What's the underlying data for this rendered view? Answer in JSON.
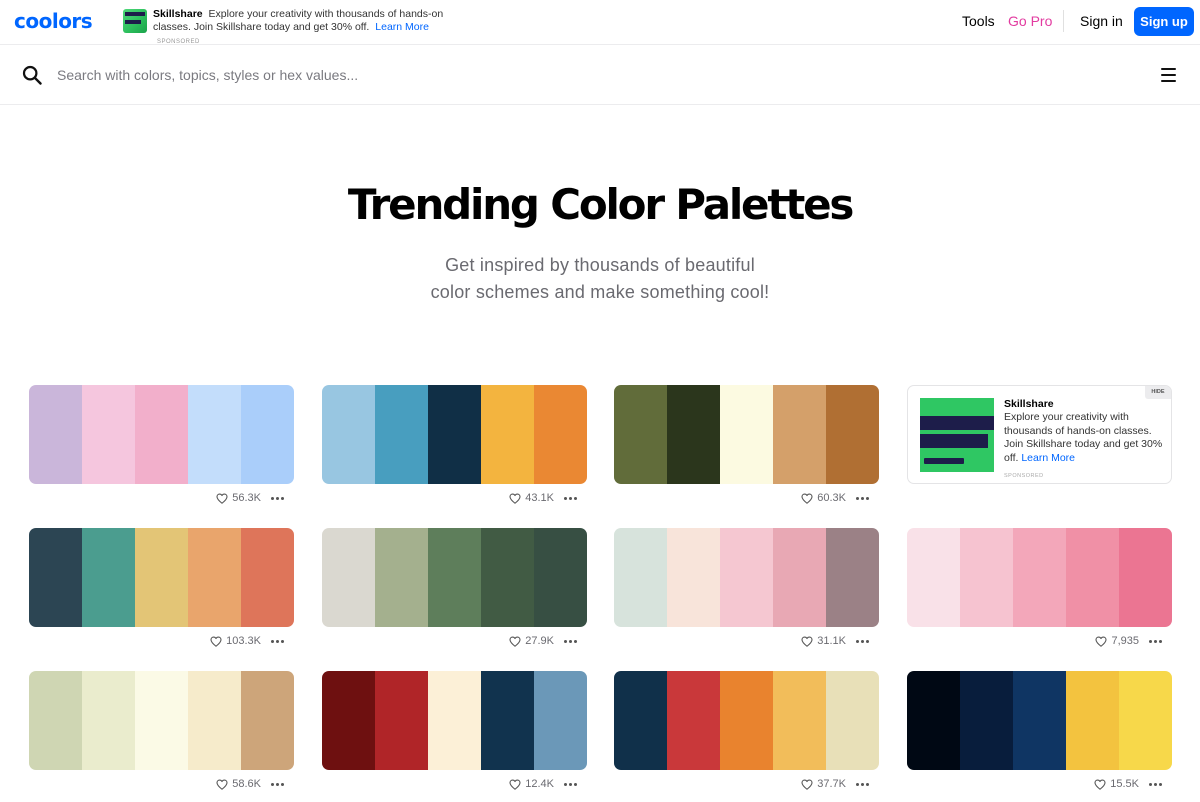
{
  "header": {
    "logo_text": "coolors",
    "ad": {
      "brand": "Skillshare",
      "text": "Explore your creativity with thousands of hands-on classes. Join Skillshare today and get 30% off.",
      "link": "Learn More",
      "sponsored": "SPONSORED"
    },
    "nav": {
      "tools": "Tools",
      "go_pro": "Go Pro",
      "sign_in": "Sign in",
      "sign_up": "Sign up"
    }
  },
  "search": {
    "placeholder": "Search with colors, topics, styles or hex values..."
  },
  "hero": {
    "title": "Trending Color Palettes",
    "subtitle_line1": "Get inspired by thousands of beautiful",
    "subtitle_line2": "color schemes and make something cool!"
  },
  "side_ad": {
    "brand": "Skillshare",
    "text": "Explore your creativity with thousands of hands-on classes. Join Skillshare today and get 30% off.",
    "link": "Learn More",
    "sponsored": "SPONSORED",
    "hide": "HIDE"
  },
  "palettes": [
    {
      "colors": [
        "#cab6da",
        "#f5c6de",
        "#f2afcb",
        "#c3ddfb",
        "#aacefa"
      ],
      "likes": "56.3K"
    },
    {
      "colors": [
        "#98c6e1",
        "#489ebf",
        "#102f46",
        "#f3b43f",
        "#ea8833"
      ],
      "likes": "43.1K"
    },
    {
      "colors": [
        "#616c3a",
        "#2b361c",
        "#fcfae1",
        "#d4a06a",
        "#b06f33"
      ],
      "likes": "60.3K"
    },
    {
      "colors": [
        "#2c4553",
        "#4b9d8f",
        "#e3c576",
        "#e9a56c",
        "#de755a"
      ],
      "likes": "103.3K"
    },
    {
      "colors": [
        "#dad8d0",
        "#a4b08e",
        "#5e7e5b",
        "#415b44",
        "#374f43"
      ],
      "likes": "27.9K"
    },
    {
      "colors": [
        "#d7e3dc",
        "#f8e4da",
        "#f5c7d1",
        "#e8a8b4",
        "#9b8186"
      ],
      "likes": "31.1K"
    },
    {
      "colors": [
        "#f9e1e8",
        "#f6c3d0",
        "#f3a7ba",
        "#f090a6",
        "#eb7592"
      ],
      "likes": "7,935"
    },
    {
      "colors": [
        "#cfd6b3",
        "#eaeccd",
        "#fbfae6",
        "#f6ebcb",
        "#cda57a"
      ],
      "likes": "58.6K"
    },
    {
      "colors": [
        "#6e1010",
        "#b02528",
        "#fcf0d7",
        "#11334e",
        "#6b98b8"
      ],
      "likes": "12.4K"
    },
    {
      "colors": [
        "#10304a",
        "#c9383a",
        "#e9832e",
        "#f2bd5a",
        "#e8e0b8"
      ],
      "likes": "37.7K"
    },
    {
      "colors": [
        "#000814",
        "#081d3c",
        "#0f3563",
        "#f3c33f",
        "#f7d84a"
      ],
      "likes": "15.5K"
    }
  ]
}
